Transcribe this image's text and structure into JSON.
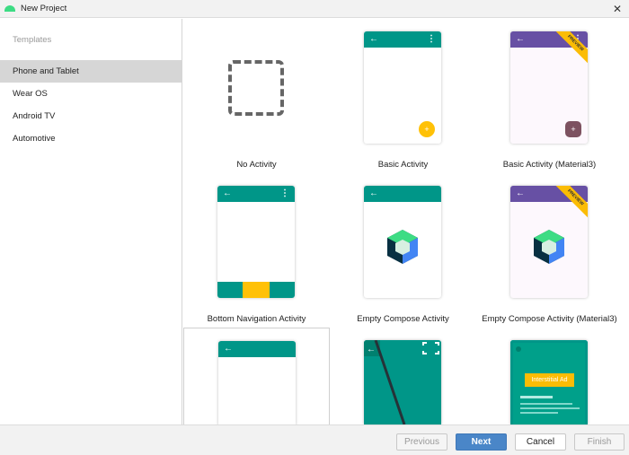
{
  "window": {
    "title": "New Project"
  },
  "sidebar": {
    "header": "Templates",
    "items": [
      {
        "label": "Phone and Tablet"
      },
      {
        "label": "Wear OS"
      },
      {
        "label": "Android TV"
      },
      {
        "label": "Automotive"
      }
    ]
  },
  "templates": [
    {
      "label": "No Activity"
    },
    {
      "label": "Basic Activity"
    },
    {
      "label": "Basic Activity (Material3)",
      "badge": "PREVIEW"
    },
    {
      "label": "Bottom Navigation Activity"
    },
    {
      "label": "Empty Compose Activity"
    },
    {
      "label": "Empty Compose Activity (Material3)",
      "badge": "PREVIEW"
    },
    {
      "label": ""
    },
    {
      "label": ""
    },
    {
      "label": "",
      "ad_text": "Interstitial Ad"
    }
  ],
  "footer": {
    "previous": "Previous",
    "next": "Next",
    "cancel": "Cancel",
    "finish": "Finish"
  },
  "colors": {
    "teal": "#009688",
    "purple": "#6750a4",
    "accent": "#ffc107",
    "primary_button": "#4a86c8"
  }
}
